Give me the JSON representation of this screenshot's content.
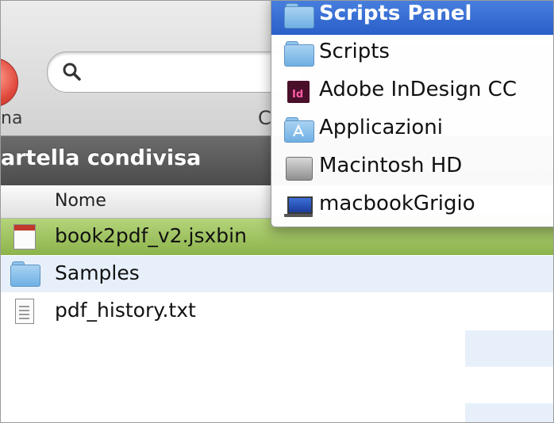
{
  "toolbar": {
    "left_label": "na",
    "middle_label": "C"
  },
  "pathbar": {
    "title": "artella condivisa"
  },
  "columns": {
    "name_header": "Nome"
  },
  "files": [
    {
      "name": "book2pdf_v2.jsxbin",
      "icon": "jsxbin-file-icon",
      "selected": true
    },
    {
      "name": "Samples",
      "icon": "folder-icon",
      "selected": false
    },
    {
      "name": "pdf_history.txt",
      "icon": "text-file-icon",
      "selected": false
    }
  ],
  "menu": {
    "items": [
      {
        "label": "Scripts Panel",
        "icon": "folder-icon",
        "active": true
      },
      {
        "label": "Scripts",
        "icon": "folder-icon",
        "active": false
      },
      {
        "label": "Adobe InDesign CC",
        "icon": "indesign-icon",
        "icon_text": "Id",
        "active": false
      },
      {
        "label": "Applicazioni",
        "icon": "applications-folder-icon",
        "active": false
      },
      {
        "label": "Macintosh HD",
        "icon": "hard-drive-icon",
        "active": false
      },
      {
        "label": "macbookGrigio",
        "icon": "laptop-icon",
        "active": false
      }
    ]
  },
  "colors": {
    "selection_green": "#9cc25c",
    "menu_highlight": "#2f67d0",
    "alt_row": "#e7f0fa",
    "pathbar": "#5a5a5a"
  }
}
